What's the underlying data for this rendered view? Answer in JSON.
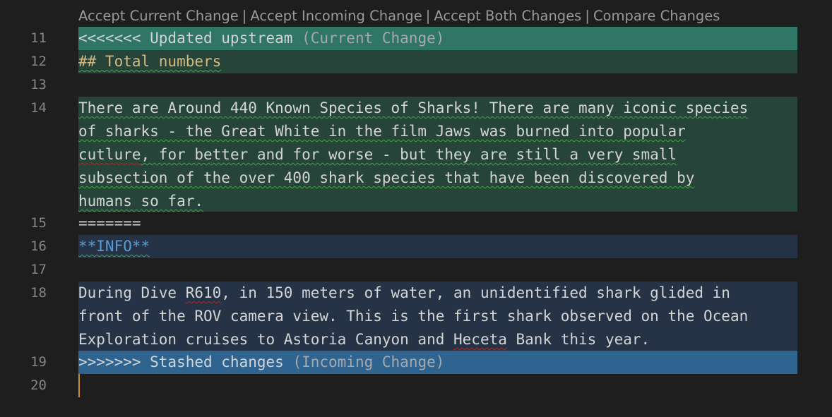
{
  "codelens": {
    "accept_current": "Accept Current Change",
    "accept_incoming": "Accept Incoming Change",
    "accept_both": "Accept Both Changes",
    "compare": "Compare Changes",
    "separator": "|"
  },
  "line_numbers": [
    "11",
    "12",
    "13",
    "14",
    "15",
    "16",
    "17",
    "18",
    "19",
    "20"
  ],
  "current": {
    "marker": "<<<<<<< Updated upstream",
    "label": "(Current Change)",
    "heading": "## Total numbers",
    "p": {
      "l1": "There are Around 440 Known Species of Sharks! There are many iconic species",
      "l2": "of sharks - the Great White in the film Jaws was burned into popular",
      "l3_misspelled": "cutlure",
      "l3_rest": ", for better and for worse - but they are still a very small",
      "l4": "subsection of the over 400 shark species that have been discovered by",
      "l5": "humans so far."
    }
  },
  "separator_line": "=======",
  "incoming": {
    "heading": "**INFO**",
    "p": {
      "l1_a": "During Dive ",
      "l1_code": "R610",
      "l1_b": ", in 150 meters of water, an unidentified shark glided in",
      "l2": "front of the ROV camera view. This is the first shark observed on the Ocean",
      "l3_a": "Exploration cruises to Astoria Canyon and ",
      "l3_name": "Heceta",
      "l3_b": " Bank this year."
    },
    "marker": ">>>>>>> Stashed changes",
    "label": "(Incoming Change)"
  },
  "colors": {
    "current_header": "#2f7666",
    "current_body": "#27443a",
    "incoming_body": "#263347",
    "incoming_header": "#2f6491"
  }
}
